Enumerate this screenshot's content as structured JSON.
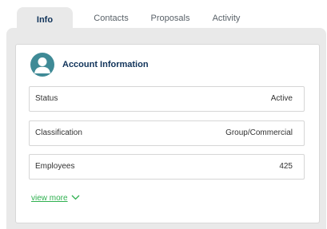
{
  "tabs": [
    {
      "label": "Info",
      "active": true
    },
    {
      "label": "Contacts",
      "active": false
    },
    {
      "label": "Proposals",
      "active": false
    },
    {
      "label": "Activity",
      "active": false
    }
  ],
  "card": {
    "title": "Account Information",
    "icon": "user-avatar-icon",
    "fields": [
      {
        "label": "Status",
        "value": "Active"
      },
      {
        "label": "Classification",
        "value": "Group/Commercial"
      },
      {
        "label": "Employees",
        "value": "425"
      }
    ],
    "view_more_label": "view more"
  },
  "colors": {
    "accent": "#2eb04f",
    "title": "#10335a",
    "avatar_bg": "#3f8a96",
    "panel_bg": "#e9e9e9"
  }
}
